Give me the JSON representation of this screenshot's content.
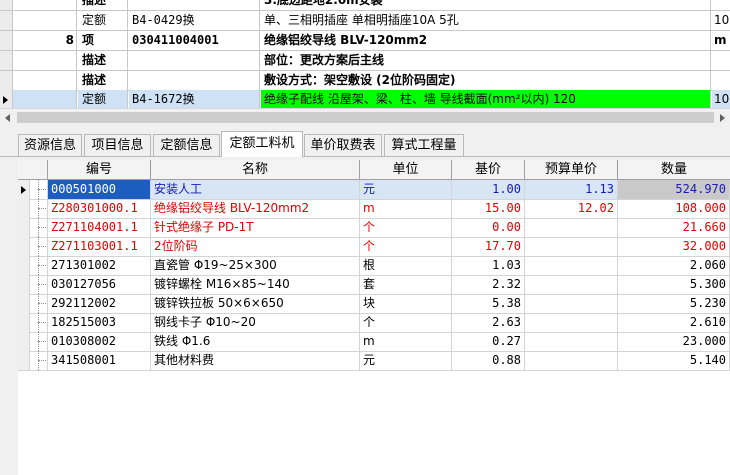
{
  "top_rows": [
    {
      "num": "",
      "type": "描述",
      "code": "",
      "name": "3.底边距地2.0m安装",
      "unit": "",
      "bold": true
    },
    {
      "num": "",
      "type": "定额",
      "code": "B4-0429换",
      "name": "单、三相明插座 单相明插座10A 5孔",
      "unit": "10",
      "bold": false
    },
    {
      "num": "8",
      "type": "项",
      "code": "030411004001",
      "name": "绝缘铝绞导线 BLV-120mm2",
      "unit": "m",
      "bold": true
    },
    {
      "num": "",
      "type": "描述",
      "code": "",
      "name": "部位：更改方案后主线",
      "unit": "",
      "bold": true
    },
    {
      "num": "",
      "type": "描述",
      "code": "",
      "name": "敷设方式：架空敷设 (2位阶码固定)",
      "unit": "",
      "bold": true
    },
    {
      "num": "",
      "type": "定额",
      "code": "B4-1672换",
      "name": "绝缘子配线 沿屋架、梁、柱、墙 导线截面(mm²以内) 120",
      "unit": "10",
      "bold": false,
      "selected": true
    }
  ],
  "tabs": [
    "资源信息",
    "项目信息",
    "定额信息",
    "定额工料机",
    "单价取费表",
    "算式工程量"
  ],
  "active_tab": 3,
  "columns": [
    "编号",
    "名称",
    "单位",
    "基价",
    "预算单价",
    "数量"
  ],
  "rows": [
    {
      "code": "000501000",
      "name": "安装人工",
      "unit": "元",
      "price": "1.00",
      "budget": "1.13",
      "qty": "524.970",
      "color": "blue"
    },
    {
      "code": "Z280301000.1",
      "name": "绝缘铝绞导线 BLV-120mm2",
      "unit": "m",
      "price": "15.00",
      "budget": "12.02",
      "qty": "108.000",
      "color": "red"
    },
    {
      "code": "Z271104001.1",
      "name": "针式绝缘子 PD-1T",
      "unit": "个",
      "price": "0.00",
      "budget": "",
      "qty": "21.660",
      "color": "red"
    },
    {
      "code": "Z271103001.1",
      "name": "2位阶码",
      "unit": "个",
      "price": "17.70",
      "budget": "",
      "qty": "32.000",
      "color": "red"
    },
    {
      "code": "271301002",
      "name": "直瓷管 Φ19~25×300",
      "unit": "根",
      "price": "1.03",
      "budget": "",
      "qty": "2.060",
      "color": "black"
    },
    {
      "code": "030127056",
      "name": "镀锌螺栓 M16×85~140",
      "unit": "套",
      "price": "2.32",
      "budget": "",
      "qty": "5.300",
      "color": "black"
    },
    {
      "code": "292112002",
      "name": "镀锌铁拉板 50×6×650",
      "unit": "块",
      "price": "5.38",
      "budget": "",
      "qty": "5.230",
      "color": "black"
    },
    {
      "code": "182515003",
      "name": "钢线卡子 Φ10~20",
      "unit": "个",
      "price": "2.63",
      "budget": "",
      "qty": "2.610",
      "color": "black"
    },
    {
      "code": "010308002",
      "name": "铁线 Φ1.6",
      "unit": "m",
      "price": "0.27",
      "budget": "",
      "qty": "23.000",
      "color": "black"
    },
    {
      "code": "341508001",
      "name": "其他材料费",
      "unit": "元",
      "price": "0.88",
      "budget": "",
      "qty": "5.140",
      "color": "black"
    }
  ]
}
